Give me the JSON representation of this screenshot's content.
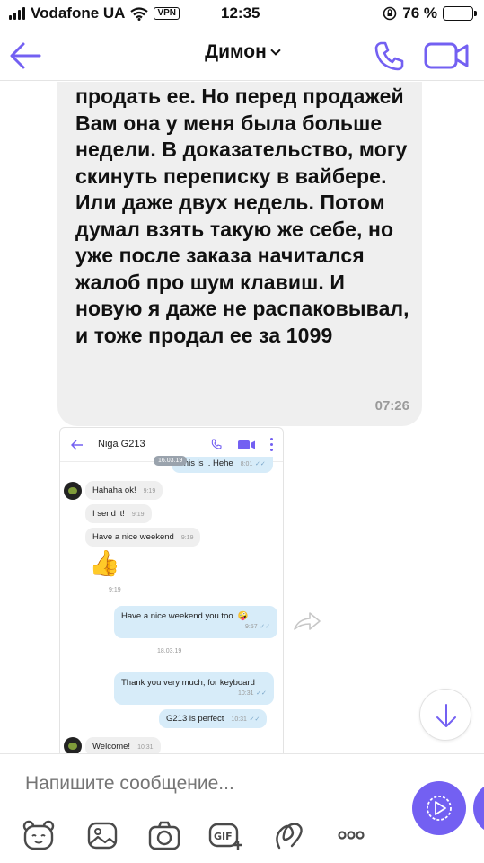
{
  "status_bar": {
    "carrier": "Vodafone UA",
    "vpn": "VPN",
    "time": "12:35",
    "battery": "76 %",
    "battery_level": 0.76
  },
  "header": {
    "title": "Димон"
  },
  "message": {
    "text": "продать ее. Но перед продажей Вам она у меня была больше недели. В доказательство, могу скинуть переписку в вайбере. Или даже двух недель. Потом думал взять такую же себе, но уже после заказа начитался жалоб про шум клавиш. И новую я даже не распаковывал, и тоже продал ее за 1099",
    "time": "07:26"
  },
  "screenshot": {
    "title": "Niga G213",
    "messages": [
      {
        "text": "This is I. Hehe",
        "time": "8:01"
      },
      {
        "text": "Hahaha ok!",
        "time": "9:19"
      },
      {
        "text": "I send it!",
        "time": "9:19"
      },
      {
        "text": "Have a nice weekend",
        "time": "9:19"
      },
      {
        "text": "Have a nice weekend you too. 🤪",
        "time": "9:57"
      },
      {
        "text": "Thank you very much, for keyboard",
        "time": "10:31"
      },
      {
        "text": "G213 is perfect",
        "time": "10:31"
      },
      {
        "text": "Welcome!",
        "time": "10:31"
      }
    ],
    "date_pill": "16.03.19",
    "sticker_time": "9:19",
    "date_separator": "18.03.19"
  },
  "compose": {
    "placeholder": "Напишите сообщение..."
  },
  "colors": {
    "accent": "#7360f2",
    "bubble_in": "#efefef",
    "bubble_out": "#d7ecf9"
  },
  "icons": {
    "back": "arrow-left-icon",
    "call": "phone-icon",
    "video": "video-camera-icon",
    "forward": "forward-icon",
    "scroll_down": "arrow-down-icon",
    "send": "play-icon",
    "toolbar": [
      "sticker-bear-icon",
      "gallery-icon",
      "camera-icon",
      "gif-icon",
      "doodle-icon",
      "more-icon"
    ]
  }
}
